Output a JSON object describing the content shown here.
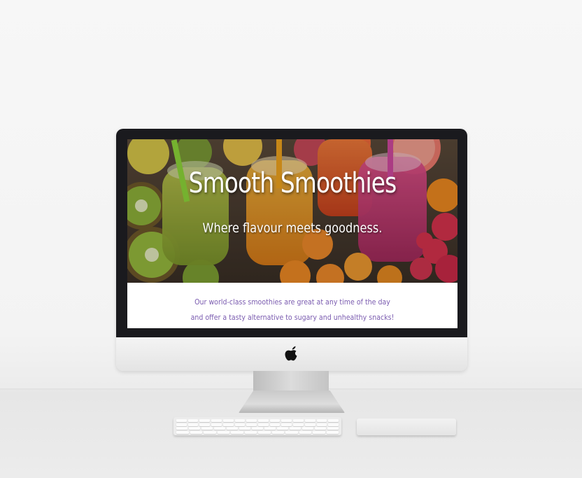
{
  "hero": {
    "title": "Smooth Smoothies",
    "subtitle": "Where flavour meets goodness."
  },
  "intro": {
    "line1": "Our world-class smoothies are great at any time of the day",
    "line2": "and offer a tasty alternative to sugary and unhealthy snacks!"
  },
  "colors": {
    "title_text": "#ffffff",
    "intro_text": "#7b5cb0",
    "bezel": "#1a1a1e",
    "screen_bg": "#ffffff"
  },
  "icons": {
    "monitor_logo": "apple-logo-icon"
  }
}
